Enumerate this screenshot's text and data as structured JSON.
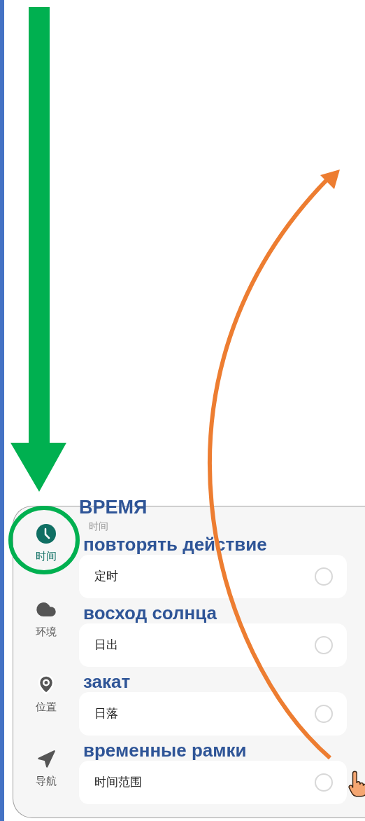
{
  "nav": [
    {
      "label": "时间",
      "kind": "clock",
      "selected": true
    },
    {
      "label": "环境",
      "kind": "weather",
      "selected": false
    },
    {
      "label": "位置",
      "kind": "location",
      "selected": false
    },
    {
      "label": "导航",
      "kind": "navigation",
      "selected": false
    }
  ],
  "section": {
    "title": "时间",
    "annotation": "ВРЕМЯ"
  },
  "options": [
    {
      "label": "定时",
      "annotation": "повторять действие",
      "selected": false
    },
    {
      "label": "日出",
      "annotation": "восход солнца",
      "selected": false
    },
    {
      "label": "日落",
      "annotation": "закат",
      "selected": false
    },
    {
      "label": "时间范围",
      "annotation": "временные рамки",
      "selected": false
    }
  ]
}
